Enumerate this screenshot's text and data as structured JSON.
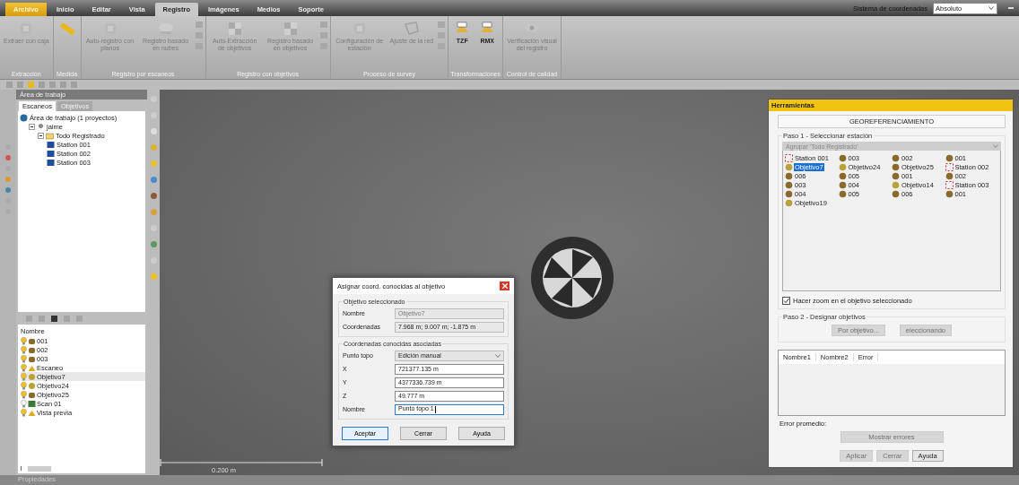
{
  "ribbon": {
    "tabs": [
      {
        "label": "Archivo",
        "kind": "file",
        "selected": false
      },
      {
        "label": "Inicio",
        "kind": "tab",
        "selected": false
      },
      {
        "label": "Editar",
        "kind": "tab",
        "selected": false
      },
      {
        "label": "Vista",
        "kind": "tab",
        "selected": false
      },
      {
        "label": "Registro",
        "kind": "tab",
        "selected": true
      },
      {
        "label": "Imágenes",
        "kind": "tab",
        "selected": false
      },
      {
        "label": "Medios",
        "kind": "tab",
        "selected": false
      },
      {
        "label": "Soporte",
        "kind": "tab",
        "selected": false
      }
    ],
    "coordinate_system": {
      "label": "Sistema de coordenadas",
      "value": "Absoluto"
    },
    "groups": [
      {
        "title": "Extracción",
        "small_tools": false,
        "buttons": [
          {
            "label": "Extraer con caja",
            "kind": "box",
            "disabled": true
          }
        ]
      },
      {
        "title": "Medida",
        "small_tools": false,
        "buttons": [
          {
            "kind": "ruler",
            "disabled": false
          }
        ]
      },
      {
        "title": "Registro por escaneos",
        "small_tools": true,
        "buttons": [
          {
            "label": "Auto-registro con planos",
            "kind": "planes",
            "disabled": true
          },
          {
            "label": "Registro basado en nubes",
            "kind": "cloud",
            "disabled": true
          }
        ]
      },
      {
        "title": "Registro con objetivos",
        "small_tools": true,
        "buttons": [
          {
            "label": "Auto-Extracción de objetivos",
            "kind": "targets",
            "disabled": true
          },
          {
            "label": "Registro basado en objetivos",
            "kind": "targets",
            "disabled": true
          }
        ]
      },
      {
        "title": "Proceso de survey",
        "small_tools": true,
        "buttons": [
          {
            "label": "Configuración de estación",
            "kind": "station",
            "disabled": true
          },
          {
            "label": "Ajuste de la red",
            "kind": "network",
            "disabled": true
          }
        ]
      },
      {
        "title": "Transformaciones",
        "small_tools": false,
        "buttons": [
          {
            "label": "TZF",
            "kind": "transform",
            "disabled": false
          },
          {
            "label": "RMX",
            "kind": "transform",
            "disabled": false
          }
        ]
      },
      {
        "title": "Control de calidad",
        "small_tools": false,
        "buttons": [
          {
            "label": "Verificación visual del registro",
            "kind": "eye",
            "disabled": true
          }
        ]
      }
    ]
  },
  "workspace_panel": {
    "title": "Área de trabajo",
    "tabs": [
      {
        "label": "Escaneos",
        "selected": true
      },
      {
        "label": "Objetivos",
        "selected": false
      }
    ],
    "tree": [
      {
        "label": "Área de trabajo (1 proyectos)",
        "kind": "workspace",
        "children": [
          {
            "label": "jaime",
            "kind": "user",
            "expanded": true,
            "children": [
              {
                "label": "Todo Registrado",
                "kind": "folder",
                "expanded": true,
                "children": [
                  {
                    "label": "Station 001",
                    "kind": "station"
                  },
                  {
                    "label": "Station 002",
                    "kind": "station"
                  },
                  {
                    "label": "Station 003",
                    "kind": "station"
                  }
                ]
              }
            ]
          }
        ]
      }
    ]
  },
  "object_list": {
    "column": "Nombre",
    "items": [
      {
        "label": "001",
        "kind": "target",
        "visible": true,
        "selected": false
      },
      {
        "label": "002",
        "kind": "target",
        "visible": true,
        "selected": false
      },
      {
        "label": "003",
        "kind": "target",
        "visible": true,
        "selected": false
      },
      {
        "label": "Escaneo",
        "kind": "scan",
        "visible": true,
        "selected": false
      },
      {
        "label": "Objetivo7",
        "kind": "objective",
        "visible": true,
        "selected": true
      },
      {
        "label": "Objetivo24",
        "kind": "objective",
        "visible": true,
        "selected": false
      },
      {
        "label": "Objetivo25",
        "kind": "target",
        "visible": true,
        "selected": false
      },
      {
        "label": "Scan 01",
        "kind": "image",
        "visible": false,
        "selected": false
      },
      {
        "label": "Vista previa",
        "kind": "scan",
        "visible": true,
        "selected": false
      }
    ]
  },
  "viewport": {
    "scale_label": "0.200 m"
  },
  "dialog": {
    "title": "Asignar coord. conocidas al objetivo",
    "selected_section": {
      "title": "Objetivo seleccionado",
      "fields": [
        {
          "label": "Nombre",
          "value": "Objetivo7",
          "disabled": true
        },
        {
          "label": "Coordenadas",
          "value": "7.968 m; 9.007 m; -1.875 m",
          "disabled": false
        }
      ]
    },
    "known_section": {
      "title": "Coordenadas conocidas asociadas",
      "fields": [
        {
          "label": "Punto topo",
          "value": "Edición manual",
          "kind": "select"
        },
        {
          "label": "X",
          "value": "721377.135 m",
          "kind": "input",
          "focused": false
        },
        {
          "label": "Y",
          "value": "4377336.739 m",
          "kind": "input",
          "focused": false
        },
        {
          "label": "Z",
          "value": "49.777 m",
          "kind": "input",
          "focused": false
        },
        {
          "label": "Nombre",
          "value": "Punto topo 1",
          "kind": "input",
          "focused": true
        }
      ]
    },
    "buttons": [
      {
        "label": "Aceptar",
        "default": true
      },
      {
        "label": "Cerrar",
        "default": false
      },
      {
        "label": "Ayuda",
        "default": false
      }
    ]
  },
  "tools_panel": {
    "title": "Herramientas",
    "heading": "GEOREFERENCIAMIENTO",
    "step1": {
      "title": "Paso 1 - Seleccionar estación",
      "group_select": "Agrupar 'Todo Registrado'",
      "items": [
        {
          "label": "Station 001",
          "kind": "station",
          "selected": false
        },
        {
          "label": "003",
          "kind": "target",
          "selected": false
        },
        {
          "label": "002",
          "kind": "target",
          "selected": false
        },
        {
          "label": "001",
          "kind": "target",
          "selected": false
        },
        {
          "label": "Objetivo7",
          "kind": "objective",
          "selected": true
        },
        {
          "label": "Objetivo24",
          "kind": "objective",
          "selected": false
        },
        {
          "label": "Objetivo25",
          "kind": "target",
          "selected": false
        },
        {
          "label": "Station 002",
          "kind": "station",
          "selected": false
        },
        {
          "label": "006",
          "kind": "target",
          "selected": false
        },
        {
          "label": "005",
          "kind": "target",
          "selected": false
        },
        {
          "label": "001",
          "kind": "target",
          "selected": false
        },
        {
          "label": "002",
          "kind": "target",
          "selected": false
        },
        {
          "label": "003",
          "kind": "target",
          "selected": false
        },
        {
          "label": "004",
          "kind": "target",
          "selected": false
        },
        {
          "label": "Objetivo14",
          "kind": "objective",
          "selected": false
        },
        {
          "label": "Station 003",
          "kind": "station",
          "selected": false
        },
        {
          "label": "004",
          "kind": "target",
          "selected": false
        },
        {
          "label": "005",
          "kind": "target",
          "selected": false
        },
        {
          "label": "006",
          "kind": "target",
          "selected": false
        },
        {
          "label": "001",
          "kind": "target",
          "selected": false
        },
        {
          "label": "Objetivo19",
          "kind": "objective",
          "selected": false
        }
      ],
      "zoom_checkbox": {
        "label": "Hacer zoom en el objetivo seleccionado",
        "checked": true
      }
    },
    "step2": {
      "title": "Paso 2 - Designar objetivos",
      "buttons": [
        {
          "label": "Por objetivo...",
          "disabled": true
        },
        {
          "label": "eleccionando",
          "disabled": true
        }
      ]
    },
    "table": {
      "columns": [
        "Nombre1",
        "Nombre2",
        "Error"
      ]
    },
    "average_error": "Error promedio:",
    "show_errors": {
      "label": "Mostrar errores",
      "disabled": true
    },
    "buttons": [
      {
        "label": "Aplicar",
        "disabled": true
      },
      {
        "label": "Cerrar",
        "disabled": true
      },
      {
        "label": "Ayuda",
        "disabled": false
      }
    ]
  },
  "status_bar": {
    "title": "Propiedades"
  }
}
